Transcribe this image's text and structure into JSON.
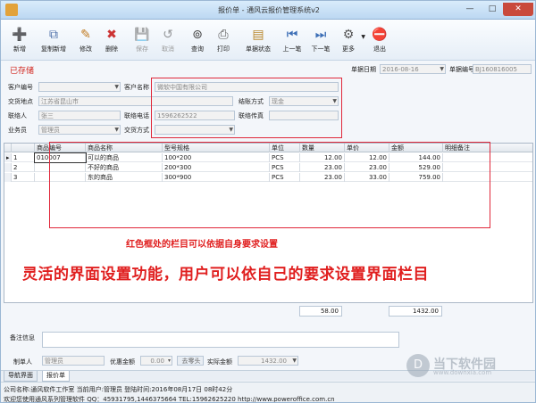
{
  "window": {
    "title": "报价单 - 通风云报价管理系统v2",
    "min_glyph": "—",
    "max_glyph": "□",
    "close_glyph": "✕"
  },
  "toolbar": {
    "new": "新增",
    "copy_new": "复制新增",
    "edit": "修改",
    "delete": "删除",
    "save": "保存",
    "cancel": "取消",
    "query": "查询",
    "print": "打印",
    "doc_status": "单据状态",
    "prev": "上一笔",
    "next": "下一笔",
    "more": "更多",
    "exit": "退出"
  },
  "status": "已存储",
  "header": {
    "doc_date_label": "单据日期",
    "doc_date": "2016-08-16",
    "doc_no_label": "单据编号",
    "doc_no": "BJ160816005",
    "customer_code_label": "客户编号",
    "customer_name_label": "客户名称",
    "customer_name": "微软中国有限公司",
    "delivery_label": "交货地点",
    "delivery": "江苏省昆山市",
    "settlement_label": "结账方式",
    "settlement": "现金",
    "contact_label": "联络人",
    "contact": "张三",
    "phone_label": "联络电话",
    "phone": "1596262522",
    "fax_label": "联络传真",
    "fax": "",
    "salesman_label": "业务员",
    "salesman": "管理员",
    "trade_label": "交货方式",
    "trade": ""
  },
  "grid": {
    "columns": [
      "商品编号",
      "商品名称",
      "型号规格",
      "单位",
      "数量",
      "单价",
      "金额",
      "明细备注"
    ],
    "rows": [
      {
        "idx": "1",
        "code": "010007",
        "name": "可以的商品",
        "spec": "100*200",
        "unit": "PCS",
        "qty": "12.00",
        "price": "12.00",
        "amount": "144.00",
        "note": ""
      },
      {
        "idx": "2",
        "code": "",
        "name": "不好的商品",
        "spec": "200*300",
        "unit": "PCS",
        "qty": "23.00",
        "price": "23.00",
        "amount": "529.00",
        "note": ""
      },
      {
        "idx": "3",
        "code": "",
        "name": "东的商品",
        "spec": "300*900",
        "unit": "PCS",
        "qty": "23.00",
        "price": "33.00",
        "amount": "759.00",
        "note": ""
      }
    ],
    "current_row_marker": "▸",
    "total_qty": "58.00",
    "total_amount": "1432.00"
  },
  "footer": {
    "remark_label": "备注信息",
    "maker_label": "制单人",
    "maker": "管理员",
    "discount_label": "优惠金额",
    "discount": "0.00",
    "round_button": "去零头",
    "actual_label": "实际金额",
    "actual": "1432.00"
  },
  "tabs": [
    "导航界面",
    "报价单"
  ],
  "statusbar": {
    "line1": "公司名称:通风软件工作室 当前用户:管理员 登陆时间:2016年08月17日 08时42分",
    "line2": "欢迎您使用通风系列管理软件 QQ：45931795,1446375664 TEL:15962625220 http://www.poweroffice.com.cn"
  },
  "annotations": {
    "small": "红色框处的栏目可以依据自身要求设置",
    "big": "灵活的界面设置功能，用户可以依自己的要求设置界面栏目",
    "box_color": "#e0283a"
  },
  "watermark": {
    "logo": "D",
    "name": "当下软件园",
    "url": "www.downxia.com"
  }
}
